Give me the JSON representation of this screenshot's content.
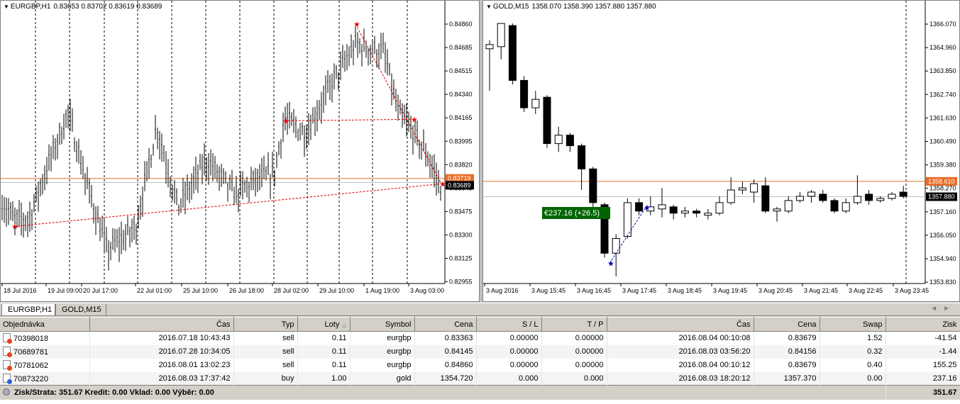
{
  "colors": {
    "bid_line": "#e0702a",
    "ask_line": "#c0c0c0",
    "trade_line": "#e00000",
    "buy_line": "#0000c0",
    "profit_bg": "#006400",
    "price_label_bg": "#000000",
    "bid_label_bg": "#e86b25"
  },
  "eurgbp_chart": {
    "symbol": "EURGBP,H1",
    "ohlc": "0.83653 0.83702 0.83619 0.83689",
    "y_labels": [
      "0.84860",
      "0.84685",
      "0.84515",
      "0.84340",
      "0.84165",
      "0.83995",
      "0.83820",
      "0.83645",
      "0.83475",
      "0.83300",
      "0.83125",
      "0.82955"
    ],
    "bid_label": "0.83719",
    "price_label": "0.83689",
    "x_labels": [
      "18 Jul 2016",
      "19 Jul 09:00",
      "20 Jul 17:00",
      "22 Jul 01:00",
      "25 Jul 10:00",
      "26 Jul 18:00",
      "28 Jul 02:00",
      "29 Jul 10:00",
      "1 Aug 19:00",
      "3 Aug 03:00"
    ]
  },
  "gold_chart": {
    "symbol": "GOLD,M15",
    "ohlc": "1358.070 1358.390 1357.880 1357.880",
    "y_labels": [
      "1366.070",
      "1364.960",
      "1363.850",
      "1362.740",
      "1361.630",
      "1360.490",
      "1359.380",
      "1358.270",
      "1357.160",
      "1356.050",
      "1354.940",
      "1353.830"
    ],
    "bid_label": "1358.610",
    "price_label": "1357.880",
    "x_labels": [
      "3 Aug 2016",
      "3 Aug 15:45",
      "3 Aug 16:45",
      "3 Aug 17:45",
      "3 Aug 18:45",
      "3 Aug 19:45",
      "3 Aug 20:45",
      "3 Aug 21:45",
      "3 Aug 22:45",
      "3 Aug 23:45"
    ],
    "profit_label": "€237.16 (+26.5)"
  },
  "chart_tabs": [
    "EURGBP,H1",
    "GOLD,M15"
  ],
  "orders_table": {
    "headers": [
      "Objednávka",
      "Čas",
      "Typ",
      "Loty",
      "Symbol",
      "Cena",
      "S / L",
      "T / P",
      "Čas",
      "Cena",
      "Swap",
      "Zisk"
    ],
    "rows": [
      [
        "70398018",
        "2016.07.18 10:43:43",
        "sell",
        "0.11",
        "eurgbp",
        "0.83363",
        "0.00000",
        "0.00000",
        "2016.08.04 00:10:08",
        "0.83679",
        "1.52",
        "-41.54"
      ],
      [
        "70689781",
        "2016.07.28 10:34:05",
        "sell",
        "0.11",
        "eurgbp",
        "0.84145",
        "0.00000",
        "0.00000",
        "2016.08.03 03:56:20",
        "0.84156",
        "0.32",
        "-1.44"
      ],
      [
        "70781062",
        "2016.08.01 13:02:23",
        "sell",
        "0.11",
        "eurgbp",
        "0.84860",
        "0.00000",
        "0.00000",
        "2016.08.04 00:10:12",
        "0.83679",
        "0.40",
        "155.25"
      ],
      [
        "70873220",
        "2016.08.03 17:37:42",
        "buy",
        "1.00",
        "gold",
        "1354.720",
        "0.000",
        "0.000",
        "2016.08.03 18:20:12",
        "1357.370",
        "0.00",
        "237.16"
      ]
    ],
    "summary": "Zisk/Strata: 351.67  Kredit: 0.00  Vklad: 0.00  Výběr: 0.00",
    "summary_total": "351.67"
  }
}
